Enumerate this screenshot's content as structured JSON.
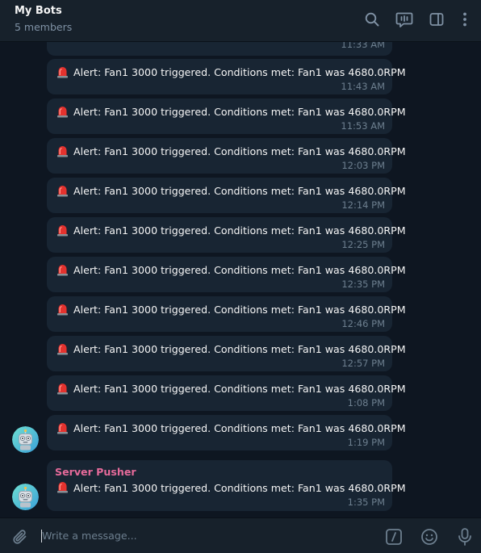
{
  "header": {
    "title": "My Bots",
    "subtitle": "5 members"
  },
  "messages": [
    {
      "text": "",
      "time": "11:33 AM",
      "partial": true
    },
    {
      "text": "Alert: Fan1 3000 triggered. Conditions met: Fan1 was 4680.0RPM",
      "time": "11:43 AM"
    },
    {
      "text": "Alert: Fan1 3000 triggered. Conditions met: Fan1 was 4680.0RPM",
      "time": "11:53 AM"
    },
    {
      "text": "Alert: Fan1 3000 triggered. Conditions met: Fan1 was 4680.0RPM",
      "time": "12:03 PM"
    },
    {
      "text": "Alert: Fan1 3000 triggered. Conditions met: Fan1 was 4680.0RPM",
      "time": "12:14 PM"
    },
    {
      "text": "Alert: Fan1 3000 triggered. Conditions met: Fan1 was 4680.0RPM",
      "time": "12:25 PM"
    },
    {
      "text": "Alert: Fan1 3000 triggered. Conditions met: Fan1 was 4680.0RPM",
      "time": "12:35 PM"
    },
    {
      "text": "Alert: Fan1 3000 triggered. Conditions met: Fan1 was 4680.0RPM",
      "time": "12:46 PM"
    },
    {
      "text": "Alert: Fan1 3000 triggered. Conditions met: Fan1 was 4680.0RPM",
      "time": "12:57 PM"
    },
    {
      "text": "Alert: Fan1 3000 triggered. Conditions met: Fan1 was 4680.0RPM",
      "time": "1:08 PM"
    },
    {
      "text": "Alert: Fan1 3000 triggered. Conditions met: Fan1 was 4680.0RPM",
      "time": "1:19 PM"
    },
    {
      "sender": "Server Pusher",
      "text": "Alert: Fan1 3000 triggered. Conditions met: Fan1 was 4680.0RPM",
      "time": "1:35 PM"
    }
  ],
  "composer": {
    "placeholder": "Write a message..."
  },
  "icons": {
    "header": [
      "search-icon",
      "video-chat-icon",
      "sidebar-toggle-icon",
      "more-options-icon"
    ],
    "message": "police-light-icon",
    "avatar": "robot-avatar",
    "composer": [
      "attach-icon",
      "bot-commands-icon",
      "emoji-icon",
      "microphone-icon"
    ]
  },
  "colors": {
    "background": "#0e1621",
    "panel": "#17212b",
    "bubble": "#182533",
    "text": "#f5f5f5",
    "muted": "#6d7f8f",
    "sender": "#e56a9a",
    "icon": "#7f91a4"
  }
}
